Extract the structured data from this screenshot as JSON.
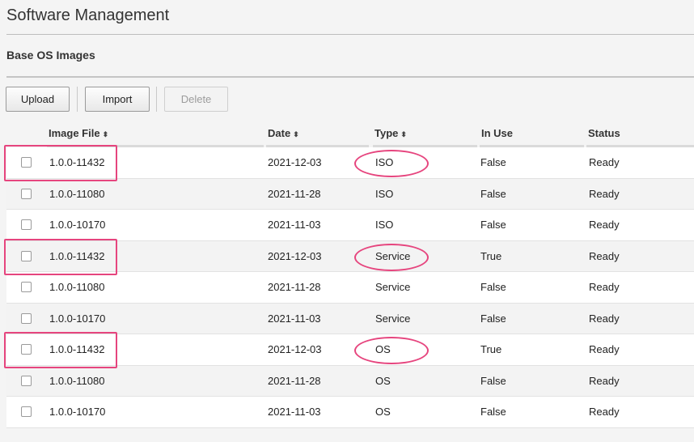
{
  "page": {
    "title": "Software Management"
  },
  "section": {
    "title": "Base OS Images"
  },
  "toolbar": {
    "upload": "Upload",
    "import": "Import",
    "delete": "Delete"
  },
  "table": {
    "columns": [
      "Image File",
      "Date",
      "Type",
      "In Use",
      "Status"
    ],
    "sort_icon": "⬍",
    "rows": [
      {
        "file": "1.0.0-11432",
        "date": "2021-12-03",
        "type": "ISO",
        "in_use": "False",
        "status": "Ready"
      },
      {
        "file": "1.0.0-11080",
        "date": "2021-11-28",
        "type": "ISO",
        "in_use": "False",
        "status": "Ready"
      },
      {
        "file": "1.0.0-10170",
        "date": "2021-11-03",
        "type": "ISO",
        "in_use": "False",
        "status": "Ready"
      },
      {
        "file": "1.0.0-11432",
        "date": "2021-12-03",
        "type": "Service",
        "in_use": "True",
        "status": "Ready"
      },
      {
        "file": "1.0.0-11080",
        "date": "2021-11-28",
        "type": "Service",
        "in_use": "False",
        "status": "Ready"
      },
      {
        "file": "1.0.0-10170",
        "date": "2021-11-03",
        "type": "Service",
        "in_use": "False",
        "status": "Ready"
      },
      {
        "file": "1.0.0-11432",
        "date": "2021-12-03",
        "type": "OS",
        "in_use": "True",
        "status": "Ready"
      },
      {
        "file": "1.0.0-11080",
        "date": "2021-11-28",
        "type": "OS",
        "in_use": "False",
        "status": "Ready"
      },
      {
        "file": "1.0.0-10170",
        "date": "2021-11-03",
        "type": "OS",
        "in_use": "False",
        "status": "Ready"
      }
    ]
  },
  "annotations": {
    "color": "#e6457e",
    "highlighted_rows": [
      0,
      3,
      6
    ]
  }
}
